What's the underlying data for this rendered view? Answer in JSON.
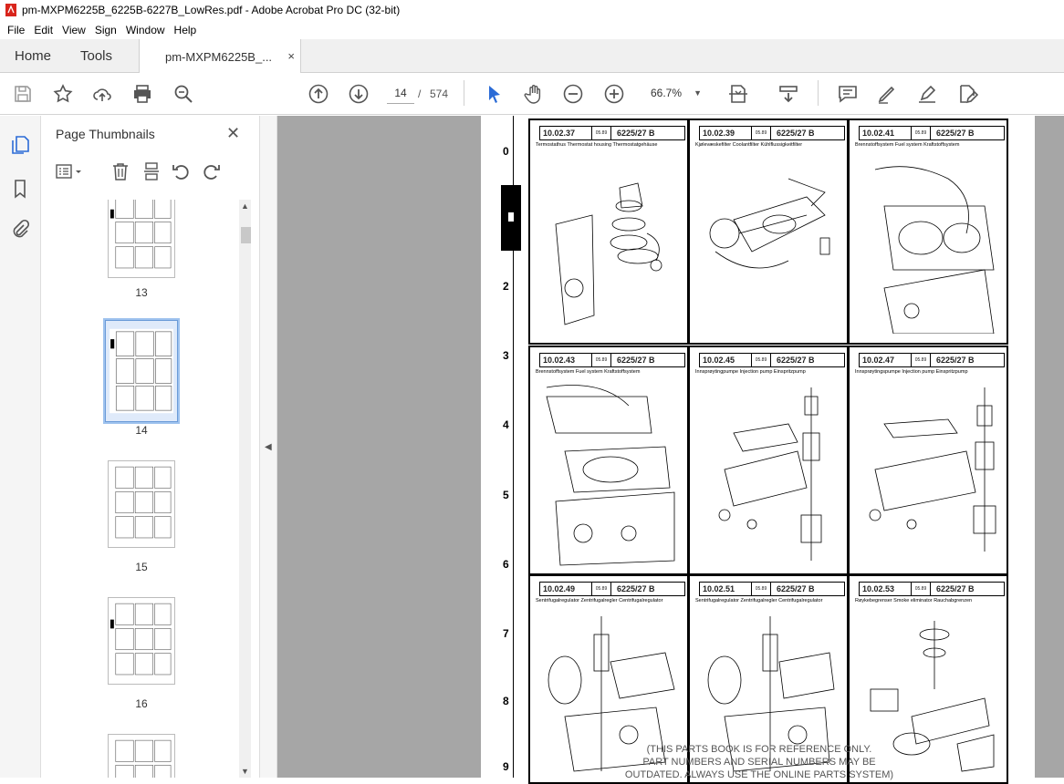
{
  "window": {
    "title": "pm-MXPM6225B_6225B-6227B_LowRes.pdf - Adobe Acrobat Pro DC (32-bit)"
  },
  "menu": [
    "File",
    "Edit",
    "View",
    "Sign",
    "Window",
    "Help"
  ],
  "tabs": {
    "home": "Home",
    "tools": "Tools",
    "document": "pm-MXPM6225B_...",
    "close": "×"
  },
  "toolbar": {
    "current_page": "14",
    "separator": "/",
    "total_pages": "574",
    "zoom": "66.7%"
  },
  "sidebar": {
    "title": "Page Thumbnails",
    "close": "✕",
    "thumbnails": [
      {
        "label": "13",
        "selected": false
      },
      {
        "label": "14",
        "selected": true
      },
      {
        "label": "15",
        "selected": false
      },
      {
        "label": "16",
        "selected": false
      }
    ]
  },
  "document": {
    "row_numbers": [
      "0",
      "2",
      "3",
      "4",
      "5",
      "6",
      "7",
      "8",
      "9"
    ],
    "row_marker": "1",
    "panes": [
      {
        "code": "10.02.37",
        "date": "05.89",
        "model": "6225/27 B",
        "subtitle": "Termostathus   Thermostat housing  Thermostatgehäuse"
      },
      {
        "code": "10.02.39",
        "date": "05.89",
        "model": "6225/27 B",
        "subtitle": "Kjølevæskefilter   Coolantfilter   Kühlflussigkeitfilter"
      },
      {
        "code": "10.02.41",
        "date": "05.89",
        "model": "6225/27 B",
        "subtitle": "Brennstoffsystem   Fuel system   Kraftstoffsystem"
      },
      {
        "code": "10.02.43",
        "date": "05.89",
        "model": "6225/27 B",
        "subtitle": "Brennstoffsystem   Fuel system   Kraftstoffsystem"
      },
      {
        "code": "10.02.45",
        "date": "05.89",
        "model": "6225/27 B",
        "subtitle": "Innsprøytingpumpe   Injection pump   Einspritzpump"
      },
      {
        "code": "10.02.47",
        "date": "05.89",
        "model": "6225/27 B",
        "subtitle": "Innsprøytingspumpe   Injection pump   Einspritzpump"
      },
      {
        "code": "10.02.49",
        "date": "05.89",
        "model": "6225/27 B",
        "subtitle": "Sentrifugalregulator   Zentrifugalregler   Centrifugalregulator"
      },
      {
        "code": "10.02.51",
        "date": "05.89",
        "model": "6225/27 B",
        "subtitle": "Sentrifugalregulator   Zentrifugalregler   Centrifugalregulator"
      },
      {
        "code": "10.02.53",
        "date": "05.89",
        "model": "6225/27 B",
        "subtitle": "Røykebegrenser   Smoke eliminator   Rauchabgrenzen"
      }
    ],
    "watermark_lines": [
      "(THIS PARTS BOOK IS FOR REFERENCE ONLY.",
      "PART NUMBERS AND SERIAL NUMBERS MAY BE",
      "OUTDATED. ALWAYS USE THE ONLINE PARTS SYSTEM)"
    ]
  },
  "colors": {
    "accent_blue": "#2b6bd6",
    "selected_thumb": "#dfeafa",
    "viewer_bg": "#a6a6a6"
  }
}
